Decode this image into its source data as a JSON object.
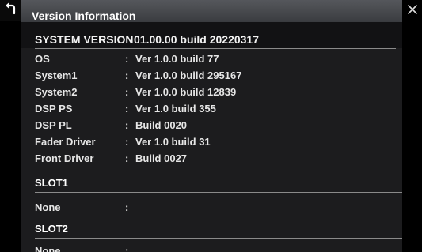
{
  "window": {
    "title": "Version Information",
    "back_icon": "back-arrow-icon",
    "close_icon": "close-icon"
  },
  "system_version": {
    "label": "SYSTEM VERSION",
    "value": "01.00.00 build 20220317"
  },
  "details": [
    {
      "label": "OS",
      "sep": ":",
      "value": "Ver 1.0.0 build 77"
    },
    {
      "label": "System1",
      "sep": ":",
      "value": "Ver 1.0.0 build 295167"
    },
    {
      "label": "System2",
      "sep": ":",
      "value": "Ver 1.0.0 build 12839"
    },
    {
      "label": "DSP PS",
      "sep": ":",
      "value": "Ver 1.0 build 355"
    },
    {
      "label": "DSP PL",
      "sep": ":",
      "value": "Build 0020"
    },
    {
      "label": "Fader Driver",
      "sep": ":",
      "value": "Ver 1.0 build 31"
    },
    {
      "label": "Front Driver",
      "sep": ":",
      "value": "Build 0027"
    }
  ],
  "slots": [
    {
      "header": "SLOT1",
      "label": "None",
      "sep": ":"
    },
    {
      "header": "SLOT2",
      "label": "None",
      "sep": ":"
    }
  ],
  "colors": {
    "background": "#000000",
    "panel": "#1c1c1e",
    "titlebar": "#48494d",
    "text": "#f2f2f2"
  }
}
